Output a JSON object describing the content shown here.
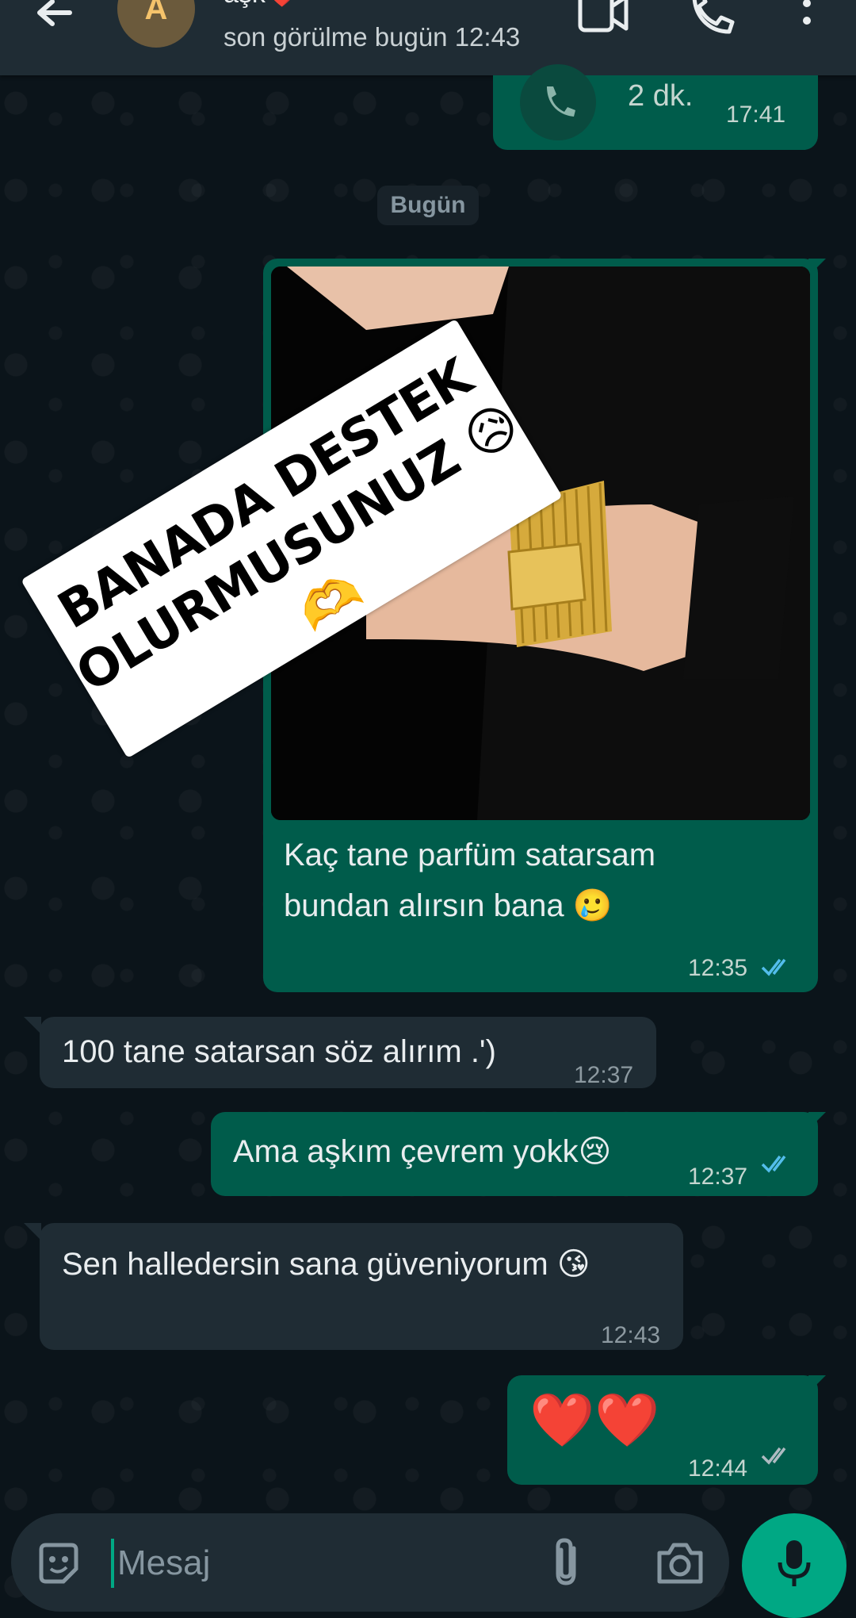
{
  "header": {
    "avatar_letter": "A",
    "contact_name": "aşk❤️",
    "last_seen": "son görülme bugün 12:43"
  },
  "messages": {
    "call": {
      "duration": "2 dk.",
      "time": "17:41"
    },
    "date_chip": "Bugün",
    "image_message": {
      "caption_line1": "Kaç tane parfüm satarsam",
      "caption_line2": "bundan alırsın bana 🥲",
      "time": "12:35"
    },
    "msg1": {
      "text": "100 tane satarsan söz alırım .')",
      "time": "12:37"
    },
    "msg2": {
      "text": "Ama aşkım çevrem yokk😢",
      "time": "12:37"
    },
    "msg3": {
      "text": "Sen halledersin sana güveniyorum 😘",
      "time": "12:43"
    },
    "msg4": {
      "text": "❤️❤️",
      "time": "12:44"
    }
  },
  "sticker": {
    "line1": "BANADA DESTEK",
    "line2": "OLURMUSUNUZ 😥🫶"
  },
  "input": {
    "placeholder": "Mesaj"
  },
  "colors": {
    "outgoing_bubble": "#005c4b",
    "incoming_bubble": "#1f2c34",
    "accent": "#00a884",
    "read_tick": "#53bdeb"
  }
}
